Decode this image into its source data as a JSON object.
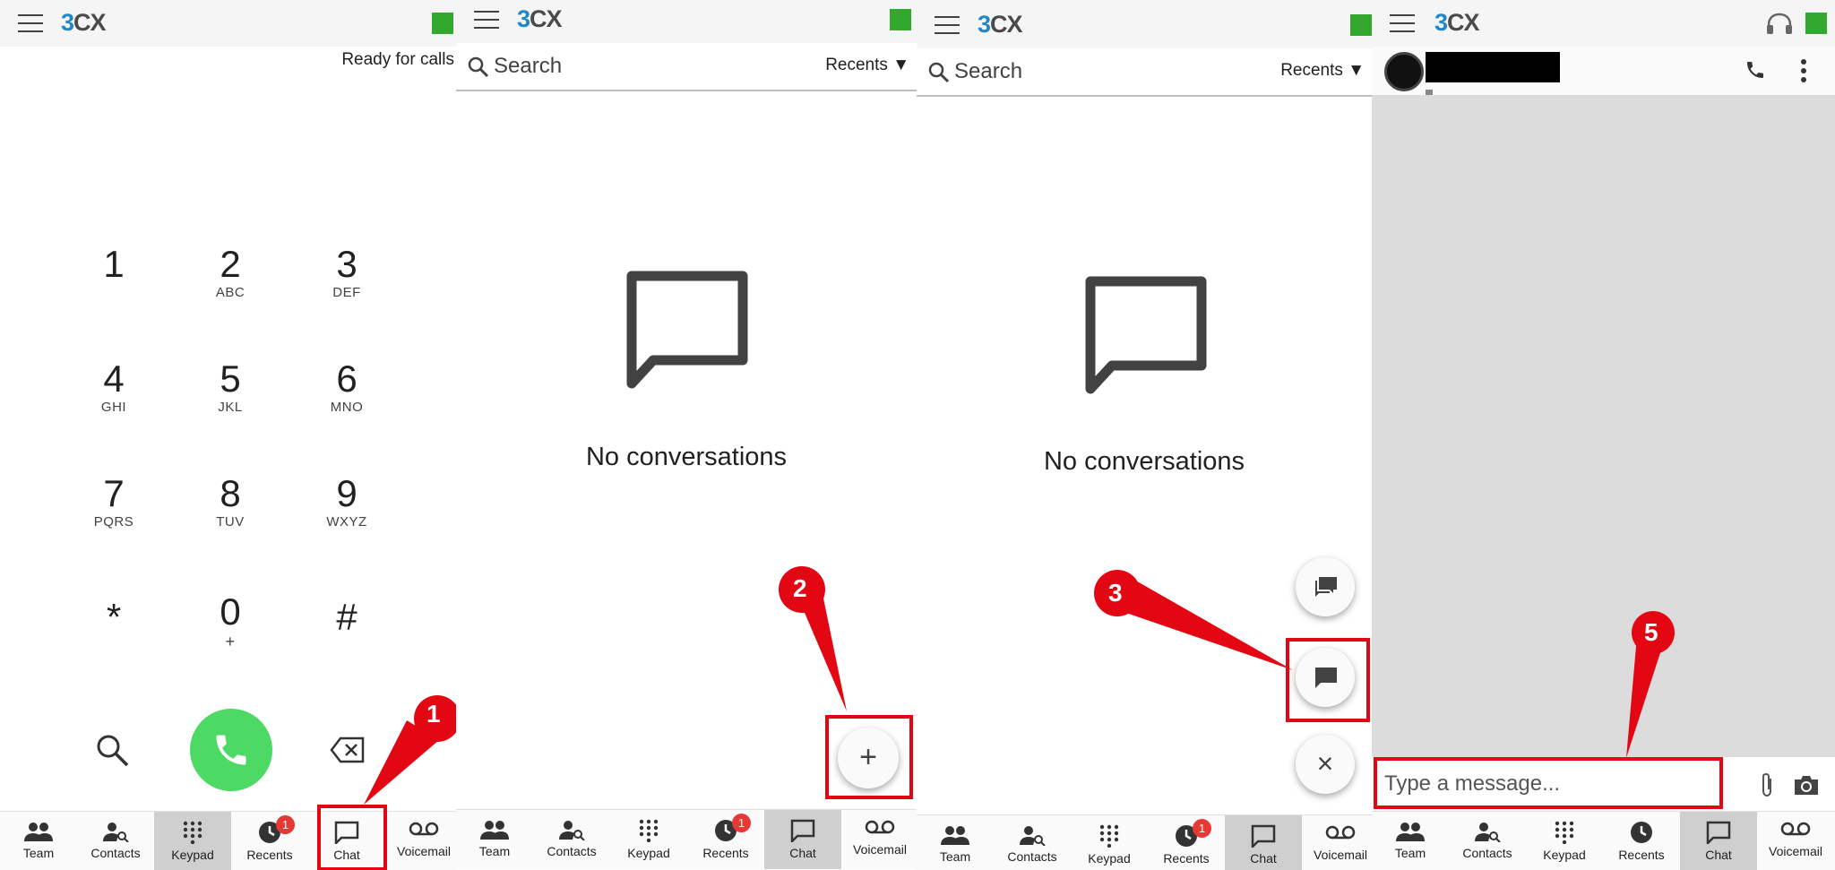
{
  "app": {
    "logo_prefix": "3",
    "logo_suffix": "CX",
    "status_color": "#33a82f",
    "accent": "#1e88c8"
  },
  "keypad": {
    "status_text": "Ready for calls",
    "keys": [
      {
        "num": "1",
        "letters": ""
      },
      {
        "num": "2",
        "letters": "ABC"
      },
      {
        "num": "3",
        "letters": "DEF"
      },
      {
        "num": "4",
        "letters": "GHI"
      },
      {
        "num": "5",
        "letters": "JKL"
      },
      {
        "num": "6",
        "letters": "MNO"
      },
      {
        "num": "7",
        "letters": "PQRS"
      },
      {
        "num": "8",
        "letters": "TUV"
      },
      {
        "num": "9",
        "letters": "WXYZ"
      },
      {
        "num": "*",
        "letters": ""
      },
      {
        "num": "0",
        "letters": "+"
      },
      {
        "num": "#",
        "letters": ""
      }
    ]
  },
  "nav": {
    "team": "Team",
    "contacts": "Contacts",
    "keypad": "Keypad",
    "recents": "Recents",
    "chat": "Chat",
    "voicemail": "Voicemail",
    "recents_badge": "1"
  },
  "chat_list": {
    "search_placeholder": "Search",
    "filter_label": "Recents",
    "empty_text": "No conversations"
  },
  "fab": {
    "plus": "+",
    "close": "×"
  },
  "chat_view": {
    "message_placeholder": "Type a message..."
  },
  "callouts": {
    "step1": "1",
    "step2": "2",
    "step3": "3",
    "step5": "5"
  },
  "annotation_color": "#e30613"
}
